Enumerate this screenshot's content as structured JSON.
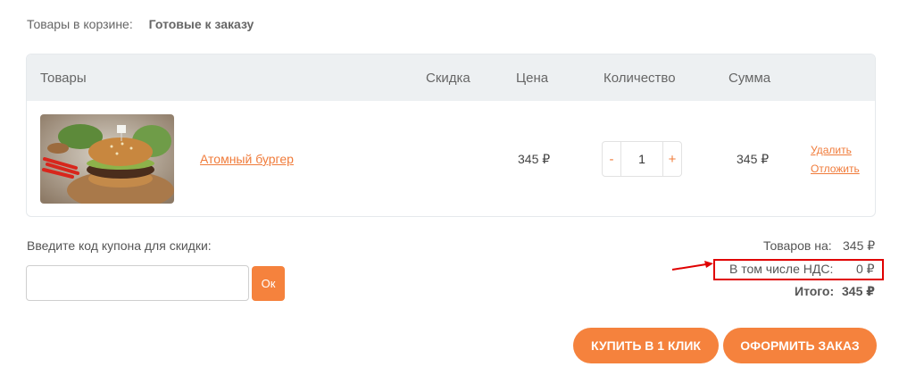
{
  "tabs": {
    "label": "Товары в корзине:",
    "active": "Готовые к заказу"
  },
  "table": {
    "headers": {
      "products": "Товары",
      "discount": "Скидка",
      "price": "Цена",
      "quantity": "Количество",
      "sum": "Сумма"
    },
    "rows": [
      {
        "name": "Атомный бургер",
        "price": "345 ₽",
        "quantity": "1",
        "minus": "-",
        "plus": "+",
        "sum": "345 ₽",
        "delete_label": "Удалить",
        "postpone_label": "Отложить"
      }
    ]
  },
  "coupon": {
    "label": "Введите код купона для скидки:",
    "value": "",
    "button": "Ок"
  },
  "summary": {
    "items_label": "Товаров на:",
    "items_value": "345 ₽",
    "vat_label": "В том числе НДС:",
    "vat_value": "0 ₽",
    "total_label": "Итого:",
    "total_value": "345 ₽"
  },
  "buttons": {
    "one_click": "КУПИТЬ В 1 КЛИК",
    "checkout": "ОФОРМИТЬ ЗАКАЗ"
  },
  "colors": {
    "accent": "#f5823d",
    "link": "#f07b3a",
    "highlight": "#e00000",
    "header_bg": "#edf0f2"
  }
}
